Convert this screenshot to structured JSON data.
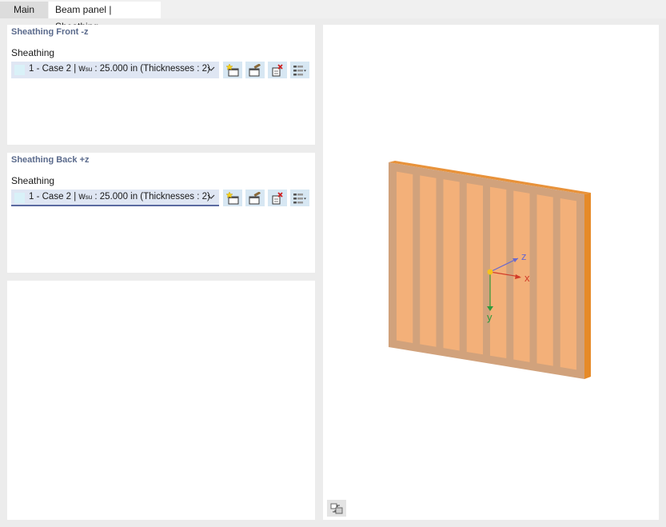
{
  "tabs": [
    {
      "label": "Main"
    },
    {
      "label": "Beam panel | Sheathing"
    }
  ],
  "sections": {
    "front": {
      "title": "Sheathing Front -z",
      "field_label": "Sheathing",
      "combo": {
        "prefix": "1 - Case 2 | w",
        "sub": "su",
        "suffix": " : 25.000 in (Thicknesses : 2)"
      }
    },
    "back": {
      "title": "Sheathing Back +z",
      "field_label": "Sheathing",
      "combo": {
        "prefix": "1 - Case 2 | w",
        "sub": "su",
        "suffix": " : 25.000 in (Thicknesses : 2)"
      }
    }
  },
  "icons": {
    "combo_swatch": "color-swatch-icon",
    "dropdown": "chevron-down-icon",
    "new": "new-icon",
    "edit": "edit-icon",
    "delete": "delete-icon",
    "library": "library-list-icon",
    "view_settings": "view-settings-icon"
  },
  "axes": {
    "x": "x",
    "y": "y",
    "z": "z"
  },
  "colors": {
    "panel_face": "#d1a27c",
    "panel_top": "#e8923a",
    "panel_side": "#e68a28",
    "stud": "#f3b079",
    "axis_x": "#d13d2a",
    "axis_y": "#2f9a3a",
    "axis_z": "#6a6acd",
    "origin": "#f6c21c",
    "section_title": "#5a6a8c",
    "combo_bg": "#dfe6f3",
    "toolbar_btn_bg": "#d7e7f3"
  }
}
